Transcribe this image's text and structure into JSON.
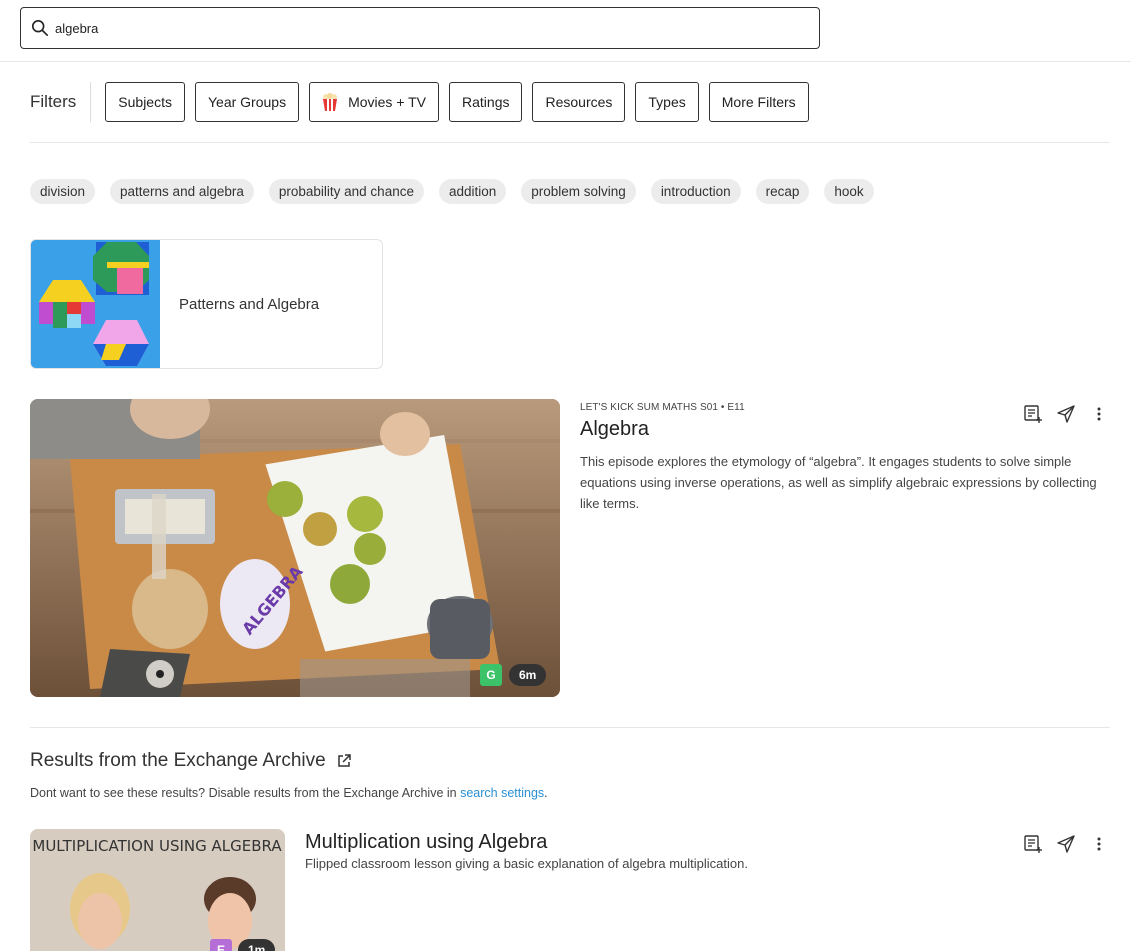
{
  "search": {
    "value": "algebra",
    "icon": "search-icon"
  },
  "filters": {
    "label": "Filters",
    "buttons": [
      {
        "label": "Subjects"
      },
      {
        "label": "Year Groups"
      },
      {
        "label": "Movies + TV",
        "icon": "popcorn-icon"
      },
      {
        "label": "Ratings"
      },
      {
        "label": "Resources"
      },
      {
        "label": "Types"
      },
      {
        "label": "More Filters"
      }
    ]
  },
  "tags": [
    "division",
    "patterns and algebra",
    "probability and chance",
    "addition",
    "problem solving",
    "introduction",
    "recap",
    "hook"
  ],
  "collection": {
    "title": "Patterns and Algebra"
  },
  "episode": {
    "meta": "LET'S KICK SUM MATHS S01 • E11",
    "title": "Algebra",
    "description": "This episode explores the etymology of “algebra”. It engages students to solve simple equations using inverse operations, as well as simplify algebraic expressions by collecting like terms.",
    "rating": "G",
    "duration": "6m",
    "thumb_text": "ALGEBRA"
  },
  "archive": {
    "title": "Results from the Exchange Archive",
    "note_prefix": "Dont want to see these results? Disable results from the Exchange Archive in ",
    "note_link": "search settings",
    "note_suffix": "."
  },
  "archive_item": {
    "title": "Multiplication using Algebra",
    "description": "Flipped classroom lesson giving a basic explanation of algebra multiplication.",
    "thumb_text": "MULTIPLICATION USING ALGEBRA",
    "rating": "E",
    "duration": "1m"
  },
  "colors": {
    "accent_link": "#2a8fd4",
    "rating_g": "#3cc36a",
    "rating_e": "#b46ed6",
    "collection_bg": "#3aa0e8"
  }
}
